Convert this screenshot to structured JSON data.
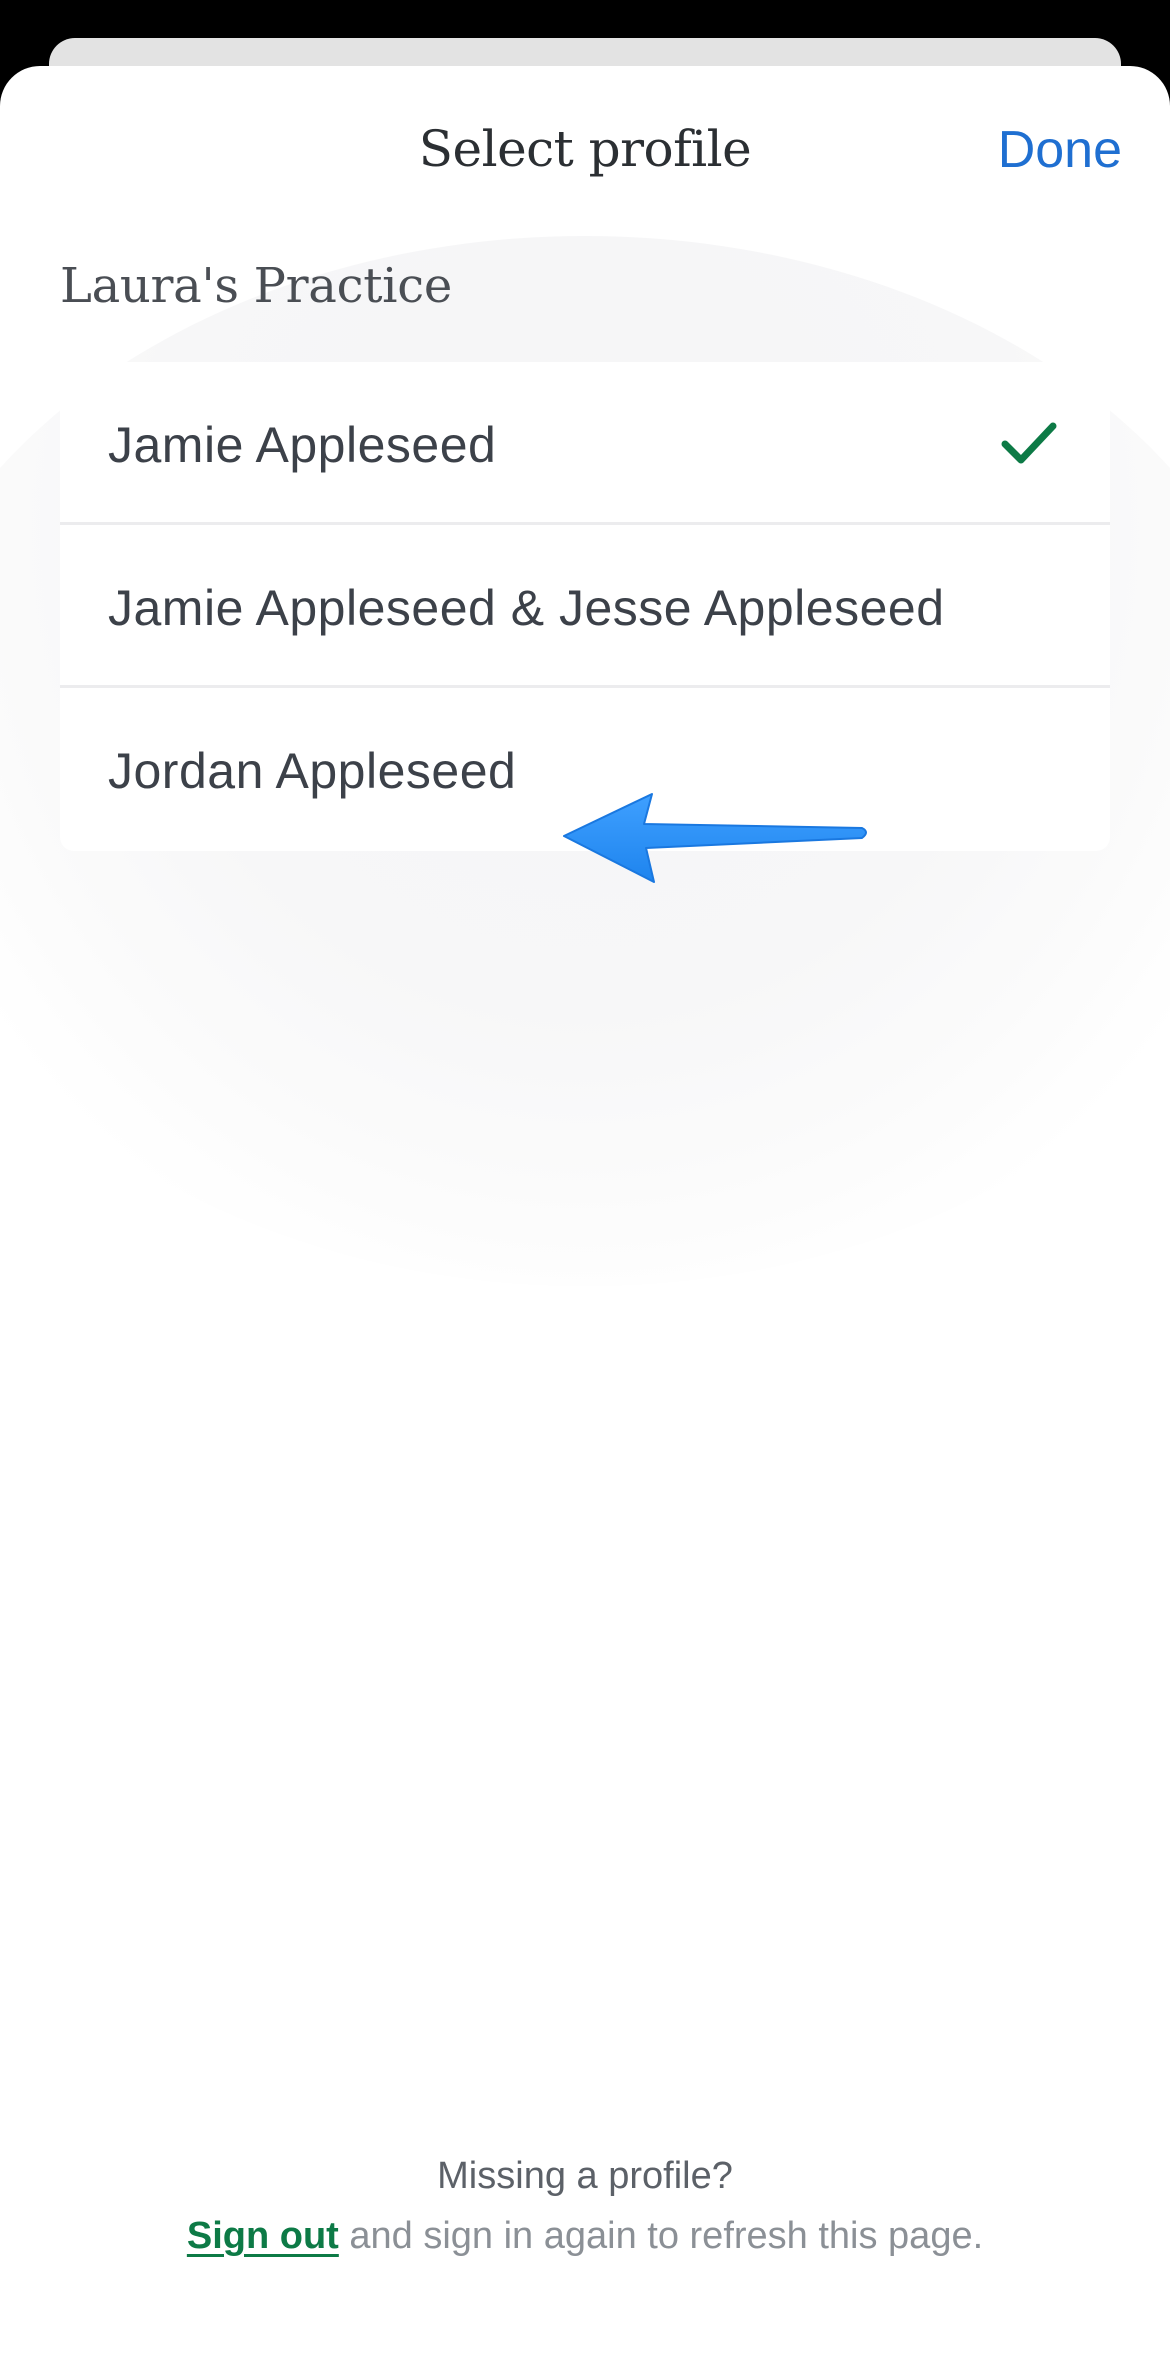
{
  "header": {
    "title": "Select profile",
    "done_label": "Done"
  },
  "practice": {
    "name": "Laura's Practice",
    "profiles": [
      {
        "name": "Jamie Appleseed",
        "selected": true
      },
      {
        "name": "Jamie Appleseed & Jesse Appleseed",
        "selected": false
      },
      {
        "name": "Jordan Appleseed",
        "selected": false
      }
    ]
  },
  "footer": {
    "question": "Missing a profile?",
    "sign_out_label": "Sign out",
    "rest_text": " and sign in again to refresh this page."
  },
  "icons": {
    "check": "checkmark-icon",
    "annotation": "arrow-annotation"
  },
  "colors": {
    "accent_blue": "#1f6fd1",
    "check_green": "#0d7a46",
    "annotation_arrow": "#2b8ff3"
  }
}
